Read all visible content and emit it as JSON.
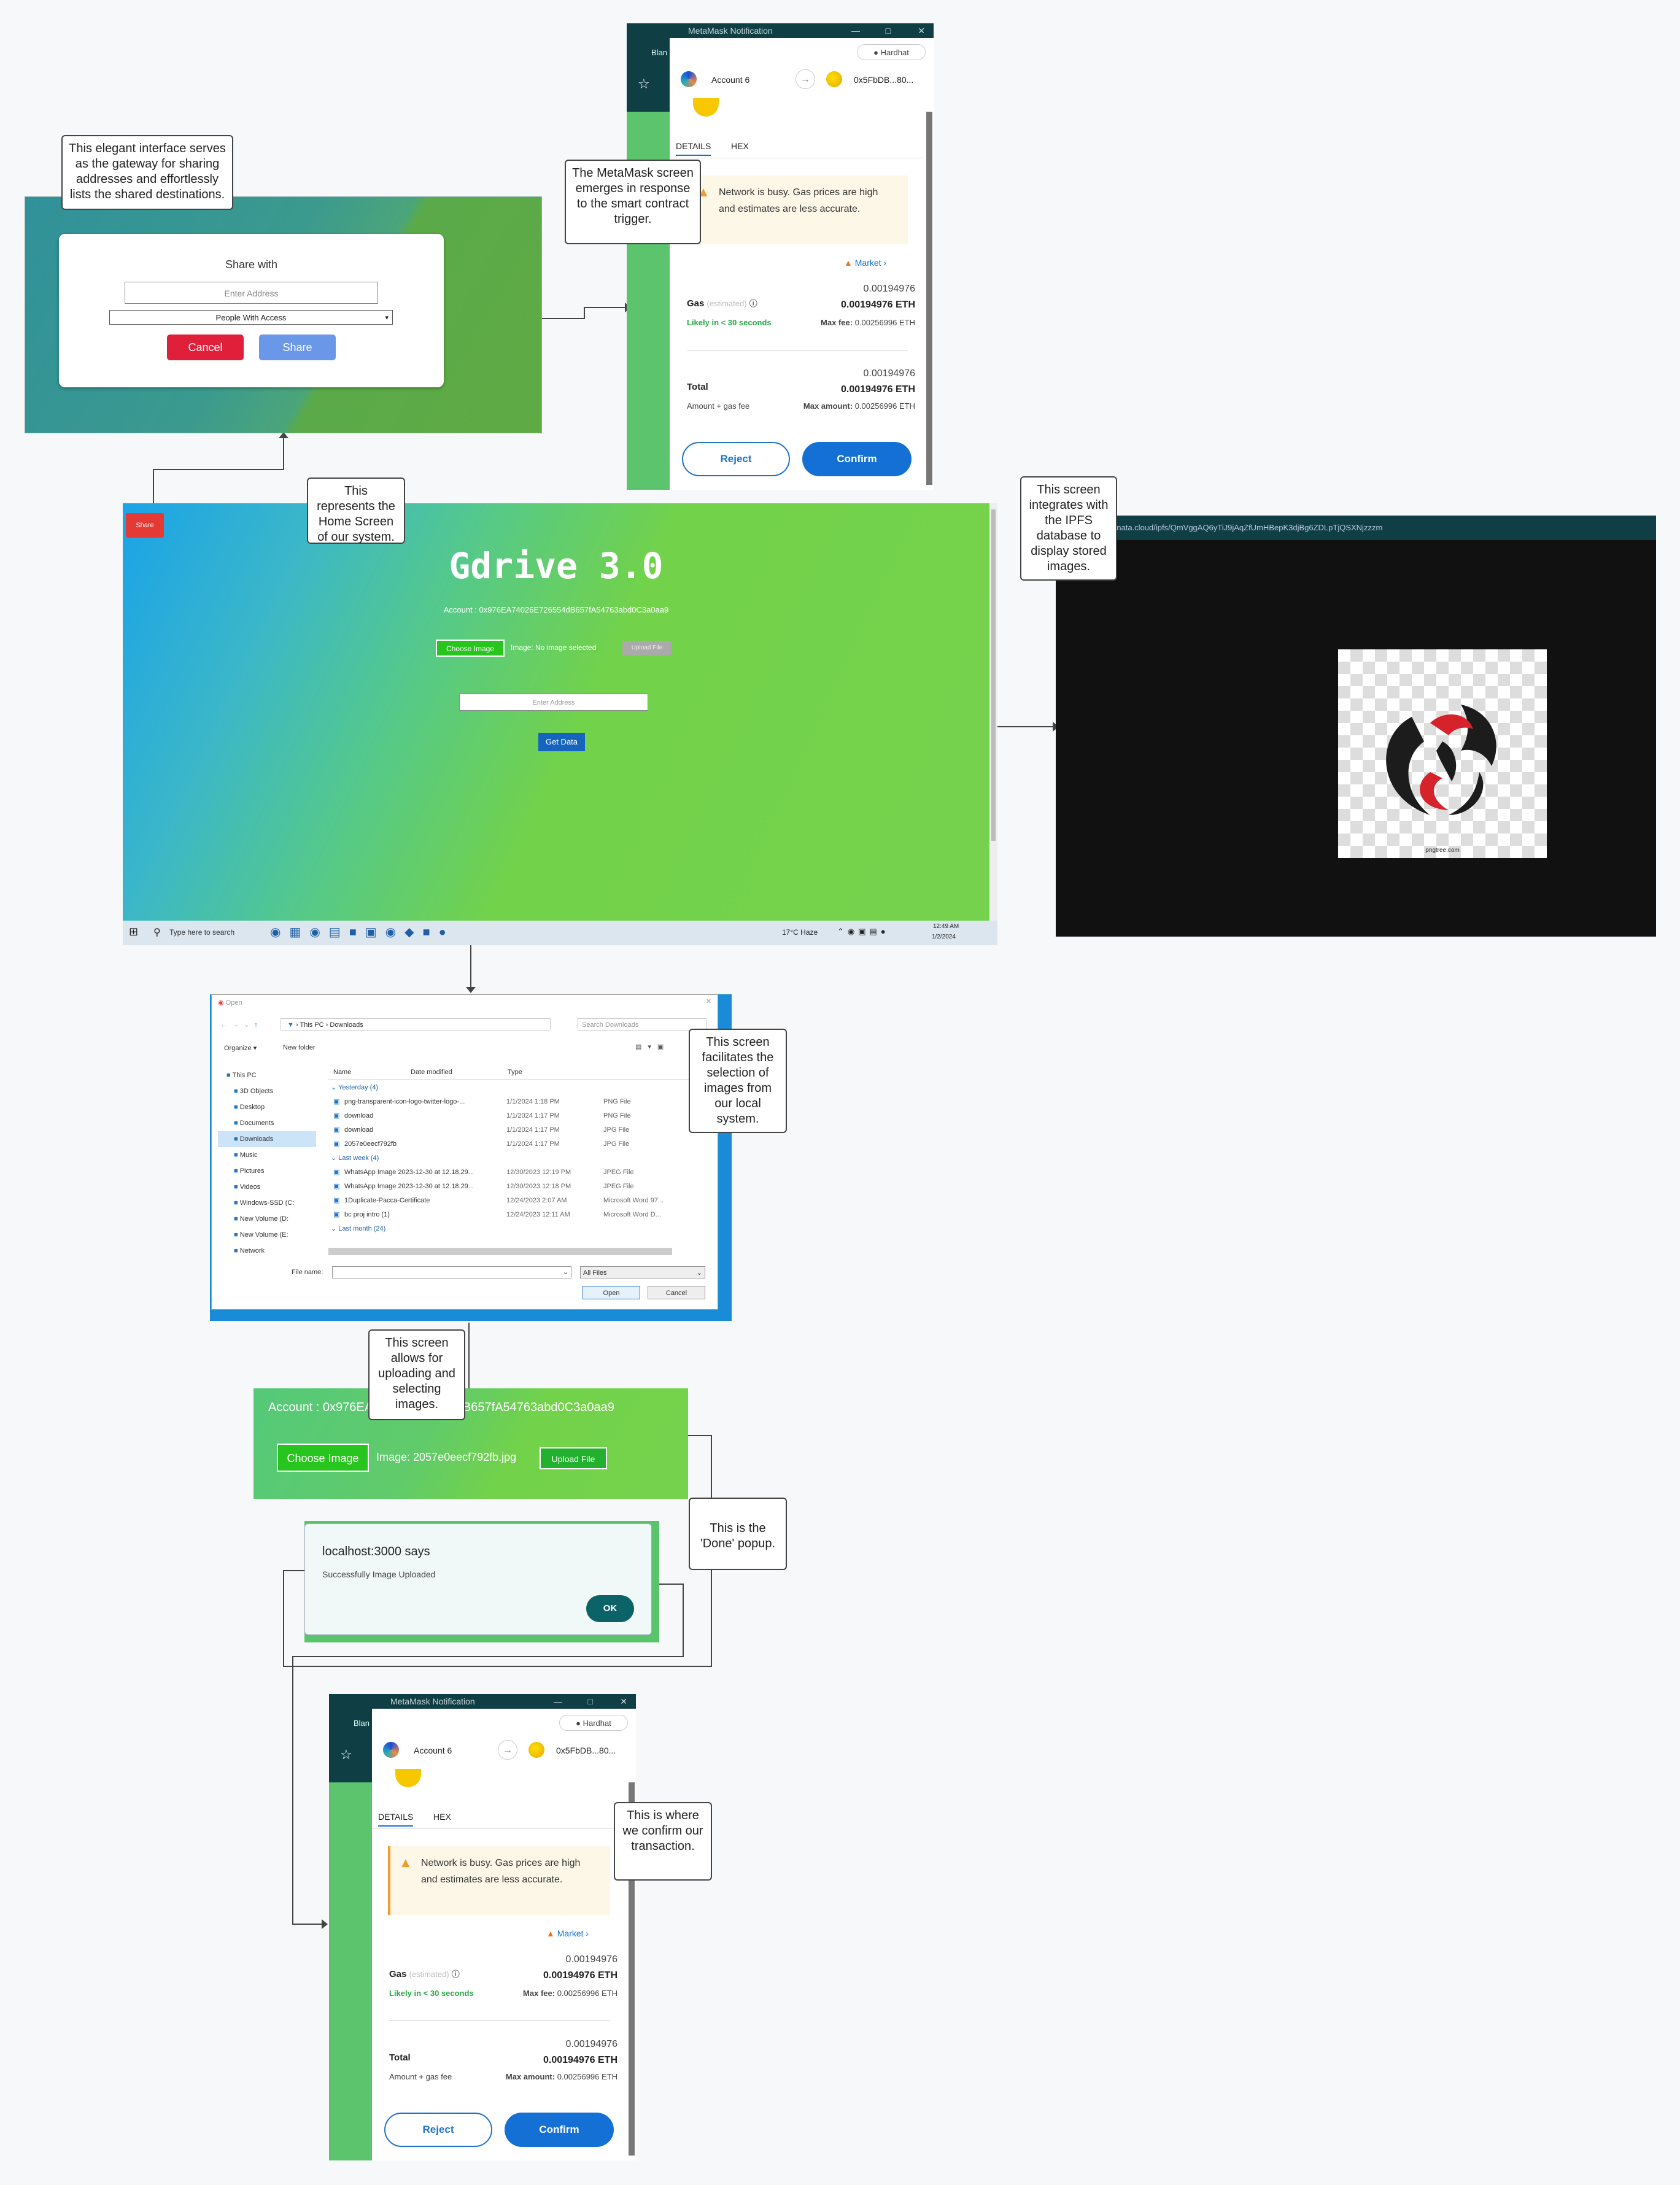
{
  "notes": {
    "share_note": "This elegant interface serves as the gateway for sharing addresses and effortlessly lists the shared destinations.",
    "metamask_note": "The MetaMask screen emerges in response to the smart contract trigger.",
    "home_note": "This represents the Home Screen of our system.",
    "ipfs_note": "This screen integrates with the IPFS database to display stored images.",
    "select_note": "This screen facilitates the selection of images from our local system.",
    "upload_note": "This screen allows for uploading and selecting images.",
    "done_note": "This is the 'Done' popup.",
    "confirm_note": "This is where we confirm our transaction."
  },
  "share_panel": {
    "title": "Share with",
    "address_placeholder": "Enter Address",
    "select_value": "People With Access",
    "cancel_label": "Cancel",
    "share_label": "Share"
  },
  "metamask": {
    "window_title": "MetaMask Notification",
    "side_label": "Blan",
    "network": "Hardhat",
    "account": "Account 6",
    "to_address": "0x5FbDB...80...",
    "tab_details": "DETAILS",
    "tab_hex": "HEX",
    "warning": "Network is busy. Gas prices are high and estimates are less accurate.",
    "market": "Market",
    "gas_label": "Gas",
    "gas_estimated": "(estimated)",
    "gas_value": "0.00194976",
    "gas_eth": "0.00194976 ETH",
    "likely": "Likely in < 30 seconds",
    "max_fee_label": "Max fee:",
    "max_fee": "0.00256996 ETH",
    "total_label": "Total",
    "total_value": "0.00194976",
    "total_eth": "0.00194976 ETH",
    "amount_gas": "Amount + gas fee",
    "max_amount_label": "Max amount:",
    "max_amount": "0.00256996 ETH",
    "reject": "Reject",
    "confirm": "Confirm"
  },
  "home": {
    "share_button": "Share",
    "title": "Gdrive 3.0",
    "account_line": "Account : 0x976EA74026E726554dB657fA54763abd0C3a0aa9",
    "choose_image": "Choose Image",
    "image_status": "Image: No image selected",
    "upload_file": "Upload File",
    "address_placeholder": "Enter Address",
    "get_data": "Get Data",
    "taskbar_search": "Type here to search",
    "weather": "17°C  Haze",
    "time": "12:49 AM",
    "date": "1/2/2024"
  },
  "ipfs": {
    "url": "y.pinata.cloud/ipfs/QmVggAQ6yTiJ9jAqZfUmHBepK3djBg6ZDLpTjQSXNjzzzm",
    "image_caption": "pngtree.com"
  },
  "file_dialog": {
    "title": "Open",
    "path_root": "This PC",
    "path_folder": "Downloads",
    "search_placeholder": "Search Downloads",
    "organize": "Organize",
    "new_folder": "New folder",
    "sidebar": [
      "This PC",
      "3D Objects",
      "Desktop",
      "Documents",
      "Downloads",
      "Music",
      "Pictures",
      "Videos",
      "Windows-SSD (C:",
      "New Volume (D:",
      "New Volume (E:",
      "Network"
    ],
    "columns": [
      "Name",
      "Date modified",
      "Type",
      "S"
    ],
    "group_yesterday": "Yesterday (4)",
    "group_lastweek": "Last week (4)",
    "group_lastmonth": "Last month (24)",
    "files_yesterday": [
      {
        "name": "png-transparent-icon-logo-twitter-logo-...",
        "date": "1/1/2024 1:18 PM",
        "type": "PNG File"
      },
      {
        "name": "download",
        "date": "1/1/2024 1:17 PM",
        "type": "PNG File"
      },
      {
        "name": "download",
        "date": "1/1/2024 1:17 PM",
        "type": "JPG File"
      },
      {
        "name": "2057e0eecf792fb",
        "date": "1/1/2024 1:17 PM",
        "type": "JPG File"
      }
    ],
    "files_lastweek": [
      {
        "name": "WhatsApp Image 2023-12-30 at 12.18.29...",
        "date": "12/30/2023 12:19 PM",
        "type": "JPEG File"
      },
      {
        "name": "WhatsApp Image 2023-12-30 at 12.18.29...",
        "date": "12/30/2023 12:18 PM",
        "type": "JPEG File"
      },
      {
        "name": "1Duplicate-Pacca-Certificate",
        "date": "12/24/2023 2:07 AM",
        "type": "Microsoft Word 97..."
      },
      {
        "name": "bc proj intro (1)",
        "date": "12/24/2023 12:11 AM",
        "type": "Microsoft Word D..."
      }
    ],
    "file_name_label": "File name:",
    "filter": "All Files",
    "open": "Open",
    "cancel": "Cancel"
  },
  "upload_panel": {
    "account_line": "Account : 0x976EA74026E726554dB657fA54763abd0C3a0aa9",
    "choose_image": "Choose Image",
    "image_status": "Image: 2057e0eecf792fb.jpg",
    "upload_file": "Upload File"
  },
  "done_popup": {
    "title": "localhost:3000 says",
    "message": "Successfully Image Uploaded",
    "ok": "OK"
  },
  "colors": {
    "accent_blue": "#1570d6",
    "metamask_title": "#0f3e45",
    "cancel_red": "#e0203a",
    "share_blue": "#6a97e8",
    "green_button": "#28c51e",
    "warning_orange": "#f29b2e"
  }
}
